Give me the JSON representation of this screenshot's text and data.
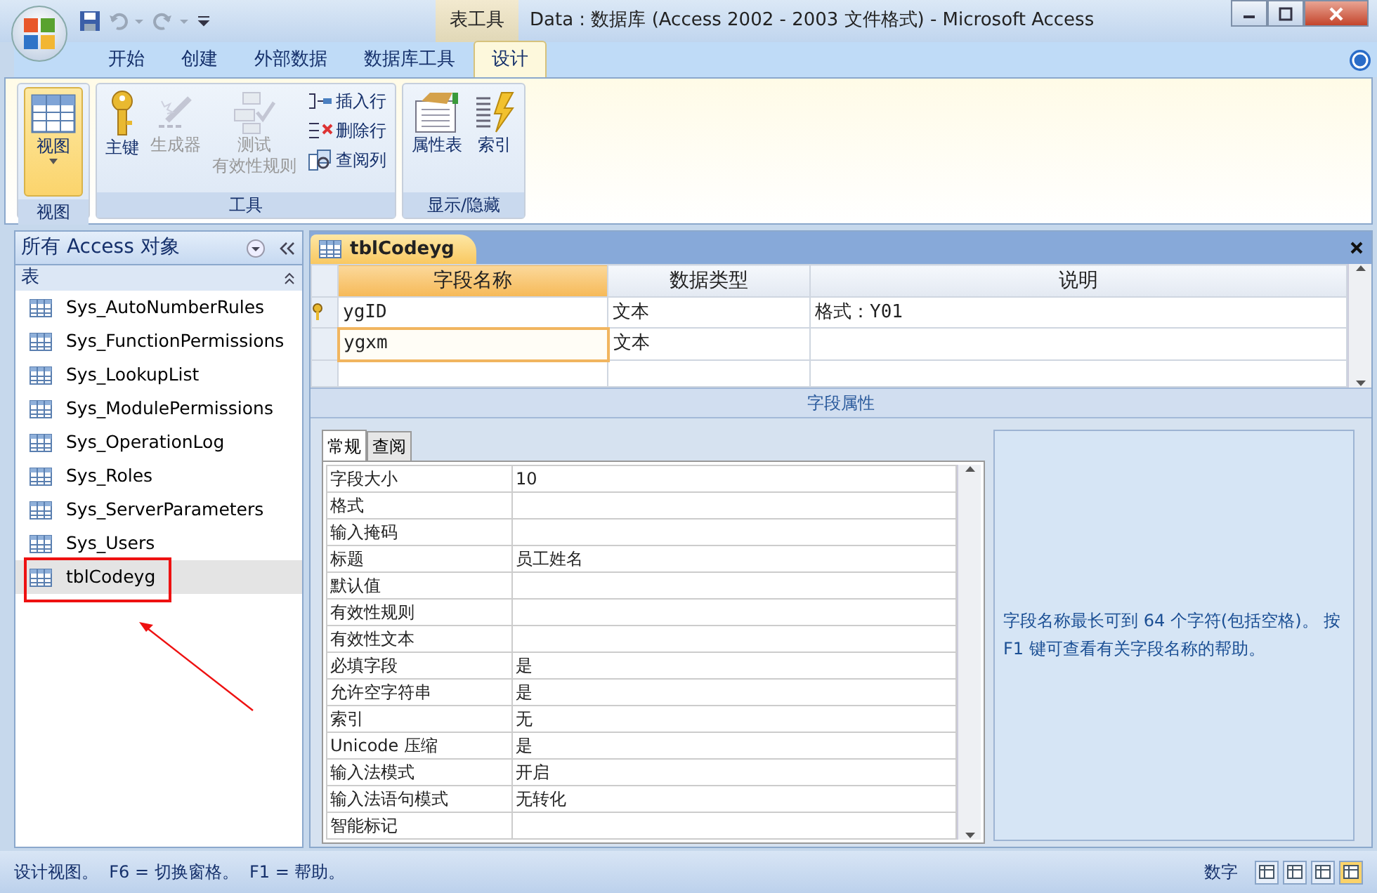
{
  "window": {
    "context_tab": "表工具",
    "title": "Data : 数据库 (Access 2002 - 2003 文件格式) - Microsoft Access"
  },
  "ribbon_tabs": [
    {
      "label": "开始",
      "selected": false
    },
    {
      "label": "创建",
      "selected": false
    },
    {
      "label": "外部数据",
      "selected": false
    },
    {
      "label": "数据库工具",
      "selected": false
    },
    {
      "label": "设计",
      "selected": true
    }
  ],
  "ribbon_groups": [
    {
      "label": "视图",
      "buttons": [
        {
          "kind": "view",
          "label": "视图",
          "disabled": false
        }
      ]
    },
    {
      "label": "工具",
      "buttons": [
        {
          "kind": "large",
          "label": "主键",
          "disabled": false
        },
        {
          "kind": "large",
          "label": "生成器",
          "disabled": true
        },
        {
          "kind": "large",
          "label": "测试",
          "label_2": "有效性规则",
          "disabled": true
        },
        {
          "kind": "small",
          "label": "插入行",
          "disabled": false
        },
        {
          "kind": "small",
          "label": "删除行",
          "disabled": false
        },
        {
          "kind": "small",
          "label": "查阅列",
          "disabled": false
        }
      ]
    },
    {
      "label": "显示/隐藏",
      "buttons": [
        {
          "kind": "large",
          "label": "属性表",
          "disabled": false
        },
        {
          "kind": "large",
          "label": "索引",
          "disabled": false
        }
      ]
    }
  ],
  "nav_pane": {
    "title": "所有 Access 对象",
    "section": "表",
    "items": [
      {
        "label": "Sys_AutoNumberRules",
        "selected": false,
        "highlighted": false
      },
      {
        "label": "Sys_FunctionPermissions",
        "selected": false,
        "highlighted": false
      },
      {
        "label": "Sys_LookupList",
        "selected": false,
        "highlighted": false
      },
      {
        "label": "Sys_ModulePermissions",
        "selected": false,
        "highlighted": false
      },
      {
        "label": "Sys_OperationLog",
        "selected": false,
        "highlighted": false
      },
      {
        "label": "Sys_Roles",
        "selected": false,
        "highlighted": false
      },
      {
        "label": "Sys_ServerParameters",
        "selected": false,
        "highlighted": false
      },
      {
        "label": "Sys_Users",
        "selected": false,
        "highlighted": false
      },
      {
        "label": "tblCodeyg",
        "selected": true,
        "highlighted": true
      }
    ]
  },
  "document_tab": {
    "label": "tblCodeyg"
  },
  "design_grid": {
    "columns": [
      "字段名称",
      "数据类型",
      "说明"
    ],
    "rows": [
      {
        "name": "ygID",
        "type": "文本",
        "description": "格式：Y01",
        "primary_key": true,
        "selected": false
      },
      {
        "name": "ygxm",
        "type": "文本",
        "primary_key": false,
        "selected": true
      }
    ]
  },
  "field_properties": {
    "title": "字段属性",
    "tabs": [
      {
        "label": "常规",
        "selected": true
      },
      {
        "label": "查阅",
        "selected": false
      }
    ],
    "rows": [
      {
        "name": "字段大小",
        "value": "10"
      },
      {
        "name": "格式"
      },
      {
        "name": "输入掩码"
      },
      {
        "name": "标题",
        "value": "员工姓名"
      },
      {
        "name": "默认值"
      },
      {
        "name": "有效性规则"
      },
      {
        "name": "有效性文本"
      },
      {
        "name": "必填字段",
        "value": "是"
      },
      {
        "name": "允许空字符串",
        "value": "是"
      },
      {
        "name": "索引",
        "value": "无"
      },
      {
        "name": "Unicode 压缩",
        "value": "是"
      },
      {
        "name": "输入法模式",
        "value": "开启"
      },
      {
        "name": "输入法语句模式",
        "value": "无转化"
      },
      {
        "name": "智能标记"
      }
    ],
    "help": "字段名称最长可到 64 个字符(包括空格)。 按 F1 键可查看有关字段名称的帮助。"
  },
  "status_bar": {
    "text": "设计视图。  F6 = 切换窗格。  F1 = 帮助。",
    "mode": "数字",
    "views": [
      {
        "selected": false
      },
      {
        "selected": false
      },
      {
        "selected": false
      },
      {
        "selected": true
      }
    ]
  }
}
